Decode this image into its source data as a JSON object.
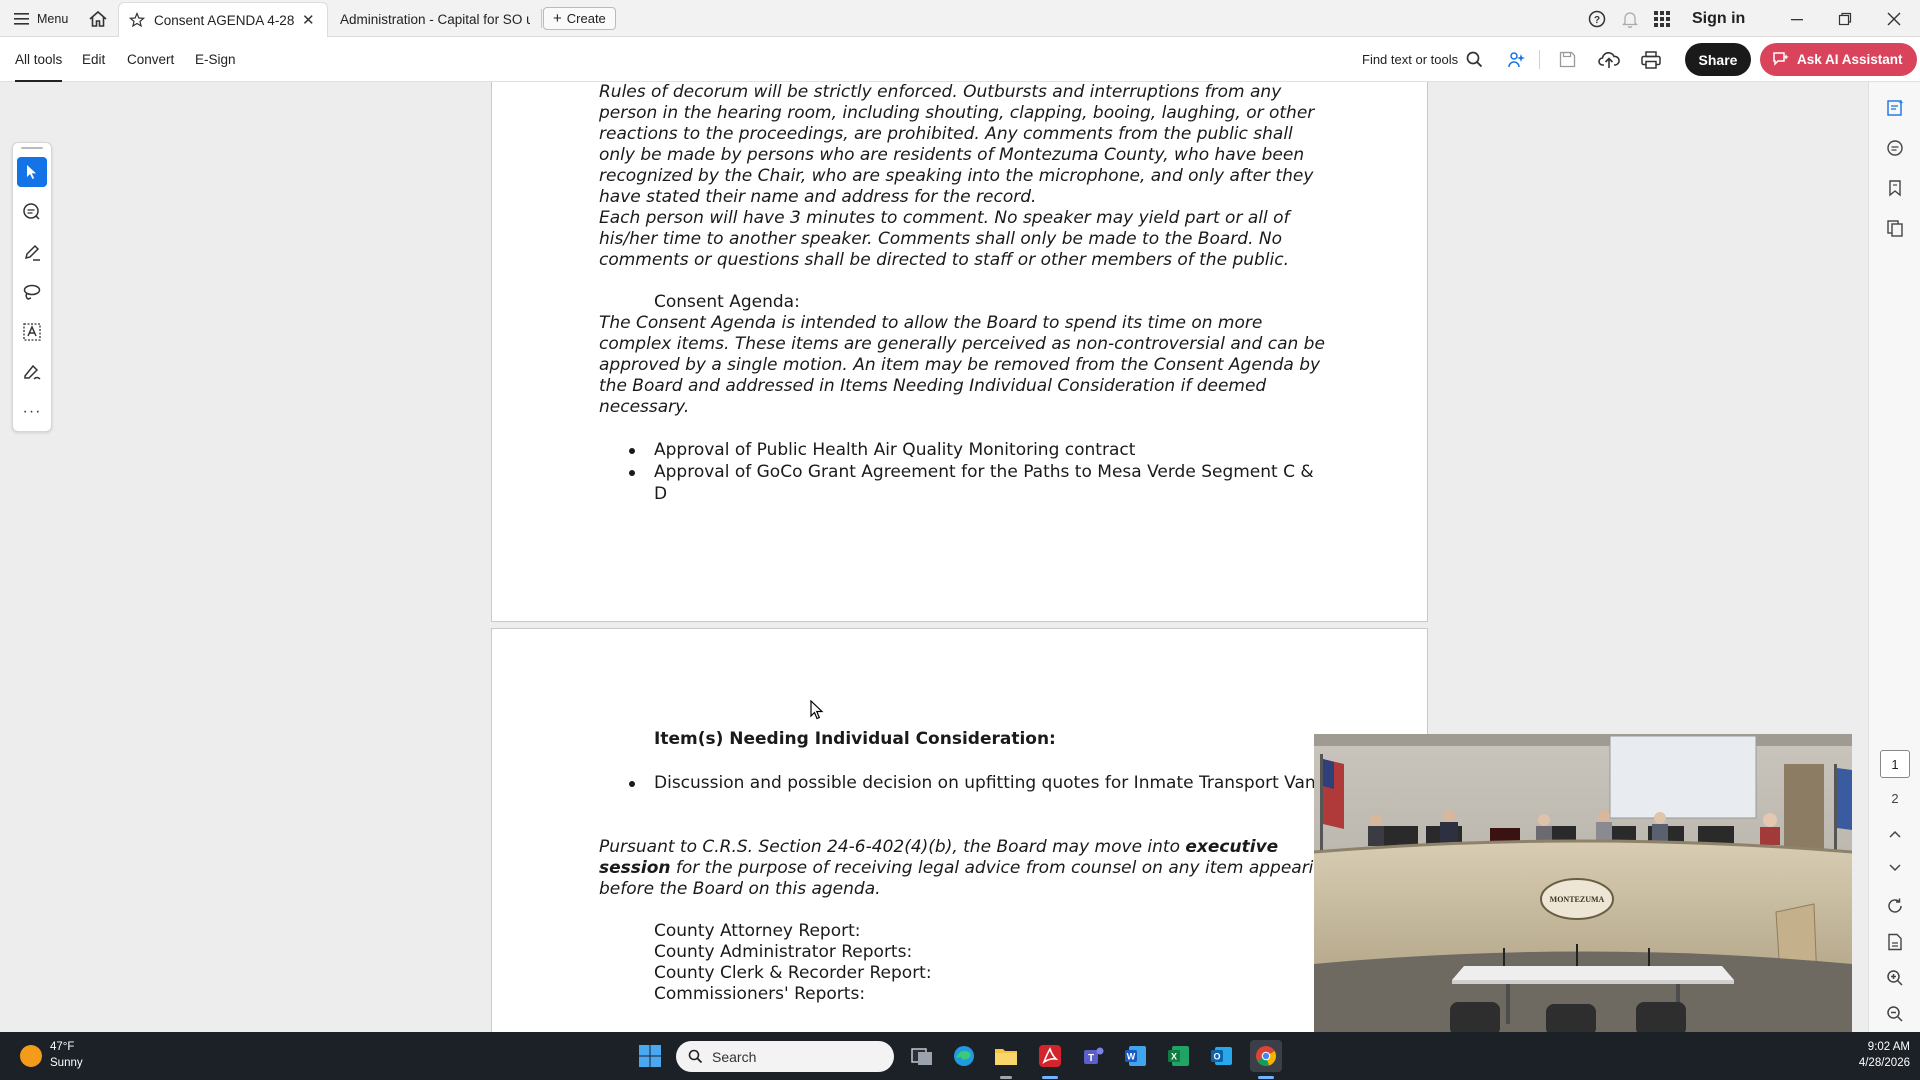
{
  "titlebar": {
    "menu_label": "Menu",
    "tabs": [
      {
        "label": "Consent AGENDA 4-28-..."
      },
      {
        "label": "Administration - Capital for SO u..."
      }
    ],
    "create_label": "Create",
    "sign_in_label": "Sign in"
  },
  "toolbar": {
    "menu": [
      "All tools",
      "Edit",
      "Convert",
      "E-Sign"
    ],
    "find_label": "Find text or tools",
    "share_label": "Share",
    "ai_label": "Ask AI Assistant"
  },
  "document": {
    "page1_lines": [
      "Rules of decorum will be strictly enforced. Outbursts and interruptions from any",
      "person in the hearing room, including shouting, clapping, booing, laughing, or other",
      "reactions to the proceedings, are prohibited. Any comments from the public shall",
      "only be made by persons who are residents of Montezuma County, who have been",
      "recognized by the Chair, who are speaking into the microphone, and only after they",
      "have stated their name and address for the record.",
      "Each person will have 3 minutes to comment. No speaker may yield part or all of",
      "his/her time to another speaker. Comments shall only be made to the Board. No",
      "comments or questions shall be directed to staff or other members of the public."
    ],
    "consent_heading": "Consent Agenda:",
    "consent_lines": [
      "The Consent Agenda is intended to allow the Board to spend its time on more",
      "complex items. These items are generally perceived as non-controversial and can be",
      "approved by a single motion. An item may be removed from the Consent Agenda by",
      "the Board and addressed in Items Needing Individual Consideration if deemed",
      "necessary."
    ],
    "consent_items": [
      "Approval of Public Health Air Quality Monitoring contract",
      "Approval of GoCo Grant Agreement for the Paths to Mesa Verde Segment C &",
      "D"
    ],
    "individual_heading": "Item(s) Needing Individual Consideration:",
    "individual_items": [
      "Discussion and possible decision on upfitting quotes for Inmate Transport Van"
    ],
    "exec_line1_a": "Pursuant to C.R.S. Section 24-6-402(4)(b), the Board may move into ",
    "exec_line1_b": "executive",
    "exec_line2_a": "session",
    "exec_line2_b": " for the purpose of receiving legal advice from counsel on any item appearing",
    "exec_line3": "before the Board on this agenda.",
    "reports": [
      "County Attorney Report:",
      "County Administrator Reports:",
      "County Clerk & Recorder Report:",
      "Commissioners' Reports:"
    ]
  },
  "rightrail": {
    "pages": [
      "1",
      "2"
    ]
  },
  "video": {
    "seal_text": "MONTEZUMA"
  },
  "taskbar": {
    "weather_temp": "47°F",
    "weather_desc": "Sunny",
    "search_label": "Search",
    "time": "9:02 AM",
    "date": "4/28/2026"
  },
  "colors": {
    "accent_blue": "#1473e6",
    "ai_button": "#d9435c",
    "taskbar": "#1c2027"
  }
}
